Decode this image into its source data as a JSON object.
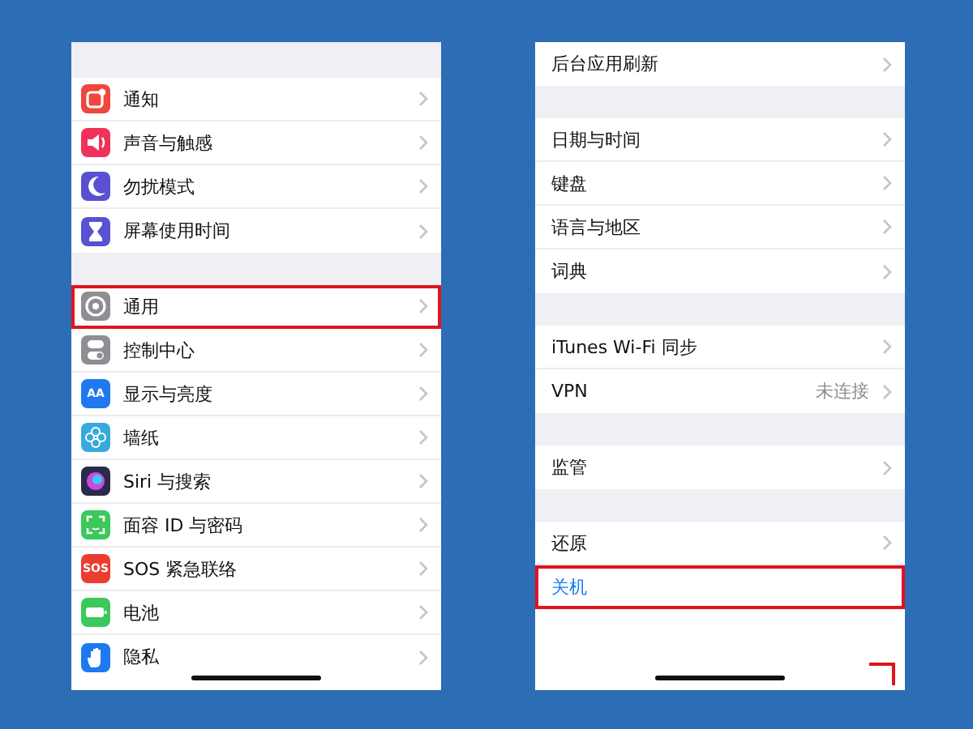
{
  "panels": [
    {
      "leading_gap": true,
      "sections": [
        {
          "rows": [
            {
              "label": "通知",
              "kind": "notification",
              "color": "#f0463c",
              "highlighted": false
            },
            {
              "label": "声音与触感",
              "kind": "speaker",
              "color": "#f0325a",
              "highlighted": false
            },
            {
              "label": "勿扰模式",
              "kind": "moon",
              "color": "#5a50d2",
              "highlighted": false
            },
            {
              "label": "屏幕使用时间",
              "kind": "hourglass",
              "color": "#5a50d2",
              "highlighted": false
            }
          ]
        },
        {
          "rows": [
            {
              "label": "通用",
              "kind": "gear",
              "color": "#8e8e93",
              "highlighted": true
            },
            {
              "label": "控制中心",
              "kind": "switches",
              "color": "#8e8e93",
              "highlighted": false
            },
            {
              "label": "显示与亮度",
              "kind": "lettered",
              "icon_text": "AA",
              "color": "#1e78f0",
              "highlighted": false
            },
            {
              "label": "墙纸",
              "kind": "flower",
              "color": "#37aadc",
              "highlighted": false
            },
            {
              "label": "Siri 与搜索",
              "kind": "orb",
              "color": "#2a2a4a",
              "highlighted": false
            },
            {
              "label": "面容 ID 与密码",
              "kind": "face",
              "color": "#3cc85a",
              "highlighted": false
            },
            {
              "label": "SOS 紧急联络",
              "kind": "lettered",
              "icon_text": "SOS",
              "color": "#eb3c32",
              "highlighted": false
            },
            {
              "label": "电池",
              "kind": "battery",
              "color": "#3cc85a",
              "highlighted": false
            },
            {
              "label": "隐私",
              "kind": "hand",
              "color": "#1e78f0",
              "highlighted": false
            }
          ]
        }
      ]
    },
    {
      "leading_gap": false,
      "sections": [
        {
          "rows": [
            {
              "label": "后台应用刷新",
              "kind": "plain",
              "highlighted": false
            }
          ]
        },
        {
          "rows": [
            {
              "label": "日期与时间",
              "kind": "plain",
              "highlighted": false
            },
            {
              "label": "键盘",
              "kind": "plain",
              "highlighted": false
            },
            {
              "label": "语言与地区",
              "kind": "plain",
              "highlighted": false
            },
            {
              "label": "词典",
              "kind": "plain",
              "highlighted": false
            }
          ]
        },
        {
          "rows": [
            {
              "label": "iTunes Wi-Fi 同步",
              "kind": "plain",
              "highlighted": false
            },
            {
              "label": "VPN",
              "value": "未连接",
              "kind": "plain",
              "highlighted": false
            }
          ]
        },
        {
          "rows": [
            {
              "label": "监管",
              "kind": "plain",
              "highlighted": false
            }
          ]
        },
        {
          "rows": [
            {
              "label": "还原",
              "kind": "plain",
              "highlighted": false
            },
            {
              "label": "关机",
              "kind": "action",
              "highlighted": true
            }
          ]
        }
      ]
    }
  ]
}
